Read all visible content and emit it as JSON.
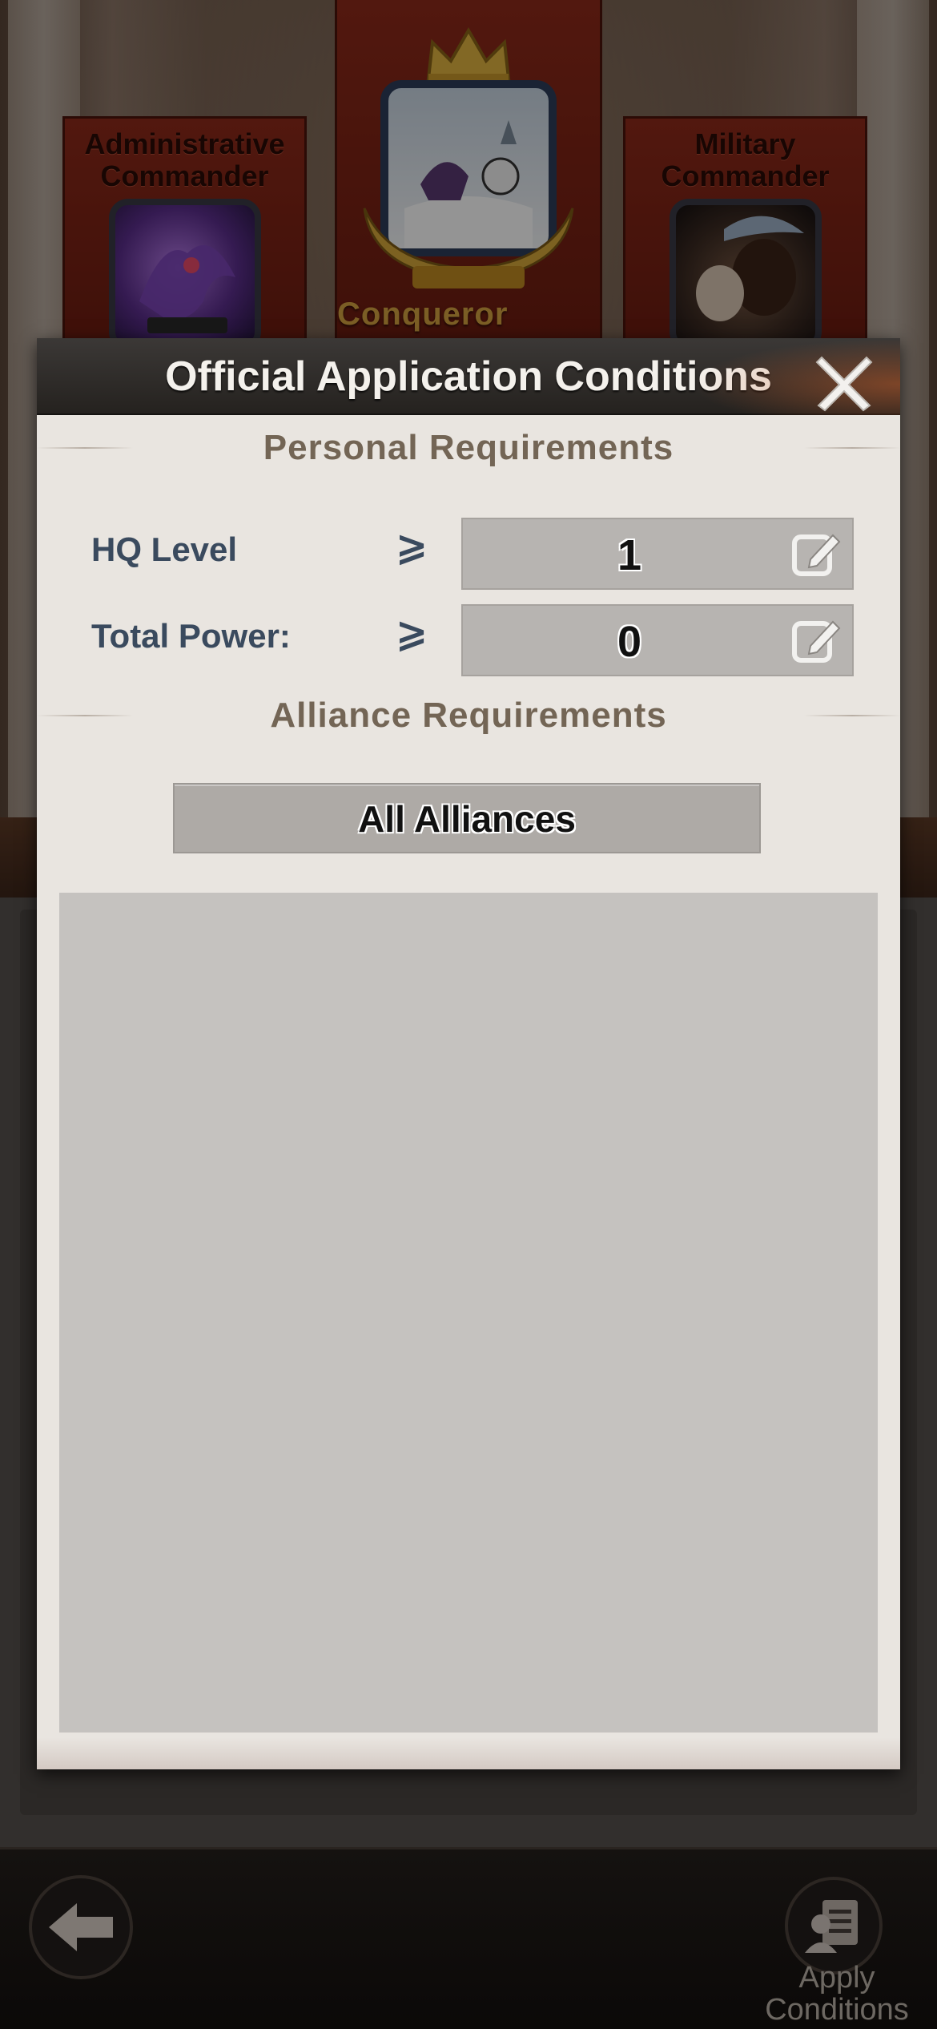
{
  "background": {
    "left_office": {
      "title_line1": "Administrative",
      "title_line2": "Commander"
    },
    "right_office": {
      "title_line1": "Military",
      "title_line2": "Commander"
    },
    "center_office": {
      "title": "Conqueror"
    }
  },
  "modal": {
    "title": "Official Application Conditions",
    "close_icon": "close-x-icon",
    "personal_section": {
      "heading": "Personal Requirements",
      "rows": [
        {
          "label": "HQ Level",
          "operator": "⩾",
          "value": "1",
          "icon": "edit-icon"
        },
        {
          "label": "Total Power:",
          "operator": "⩾",
          "value": "0",
          "icon": "edit-icon"
        }
      ]
    },
    "alliance_section": {
      "heading": "Alliance Requirements",
      "selected": "All Alliances"
    }
  },
  "bottom_bar": {
    "back_icon": "back-arrow-icon",
    "apply_icon": "apply-document-user-icon",
    "apply_label_line1": "Apply",
    "apply_label_line2": "Conditions"
  },
  "colors": {
    "header_bg": "#2e2b28",
    "title_text": "#f4f1ec",
    "label_text": "#3a4a5e",
    "section_text": "#736555",
    "field_bg": "#b7b4b1",
    "modal_bg": "#e9e5e0"
  }
}
